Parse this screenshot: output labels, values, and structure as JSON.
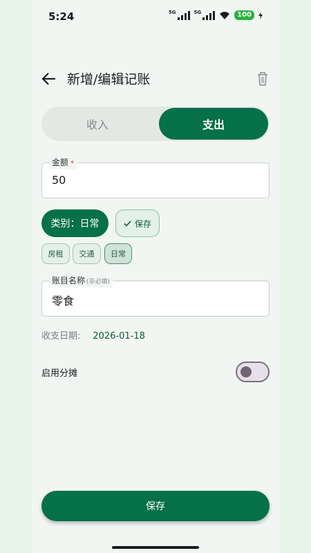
{
  "status": {
    "time": "5:24",
    "net1": "5G",
    "net2": "5G",
    "battery": "100"
  },
  "appbar": {
    "title": "新增/编辑记账"
  },
  "segment": {
    "income": "收入",
    "expense": "支出",
    "selected": "expense"
  },
  "amount": {
    "label": "金额",
    "required_mark": "*",
    "value": "50"
  },
  "category": {
    "button_label": "类别：日常",
    "save_label": "保存"
  },
  "chips": [
    {
      "label": "房租",
      "selected": false
    },
    {
      "label": "交通",
      "selected": false
    },
    {
      "label": "日常",
      "selected": true
    }
  ],
  "name": {
    "label": "账目名称",
    "hint": "(非必填)",
    "value": "零食"
  },
  "date": {
    "label": "收支日期:",
    "value": "2026-01-18"
  },
  "split": {
    "label": "启用分摊",
    "enabled": false
  },
  "footer": {
    "save_label": "保存"
  },
  "colors": {
    "primary": "#06704a",
    "background": "#f1f6f3"
  }
}
